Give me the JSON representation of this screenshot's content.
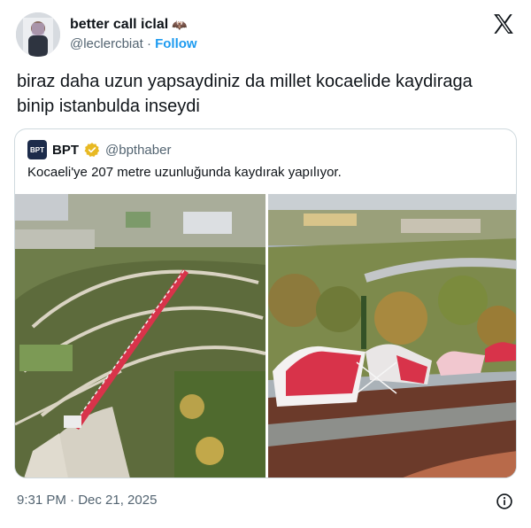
{
  "author": {
    "display_name": "better call iclal",
    "emoji": "🦇",
    "handle": "@leclercbiat",
    "separator": "·",
    "follow_label": "Follow"
  },
  "tweet": {
    "text": "biraz daha uzun yapsaydiniz da millet kocaelide kaydiraga binip istanbulda inseydi",
    "timestamp": "9:31 PM · Dec 21, 2025"
  },
  "quote": {
    "logo_text": "BPT",
    "name": "BPT",
    "handle": "@bpthaber",
    "text": "Kocaeli'ye 207 metre uzunluğunda kaydırak yapılıyor."
  },
  "colors": {
    "follow": "#1d9bf0",
    "secondary": "#536471",
    "verified": "#e8b923",
    "slide_red": "#d8334a"
  },
  "icons": {
    "logo": "x-logo-icon",
    "verified": "verified-badge-icon",
    "info": "info-icon"
  }
}
